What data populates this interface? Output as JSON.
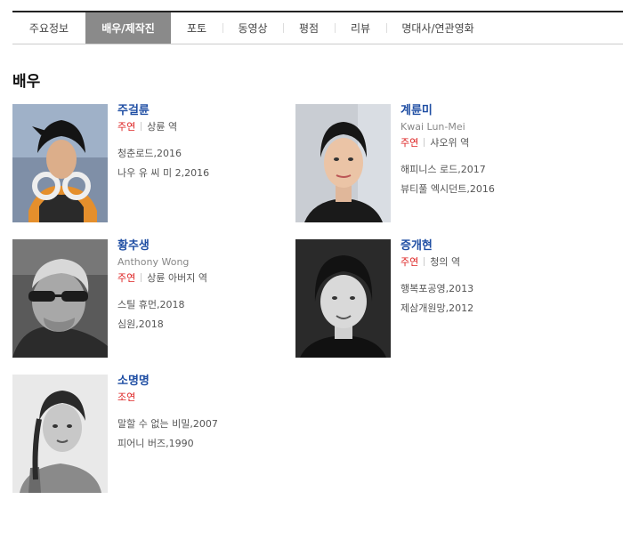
{
  "tabs": [
    {
      "label": "주요정보",
      "active": false
    },
    {
      "label": "배우/제작진",
      "active": true
    },
    {
      "label": "포토",
      "active": false
    },
    {
      "label": "동영상",
      "active": false
    },
    {
      "label": "평점",
      "active": false
    },
    {
      "label": "리뷰",
      "active": false
    },
    {
      "label": "명대사/연관영화",
      "active": false
    }
  ],
  "section": {
    "title": "배우"
  },
  "actors": [
    {
      "name": "주걸륜",
      "english_name": "",
      "role_type": "주연",
      "role_name": "상륜 역",
      "films": [
        "청춘로드,2016",
        "나우 유 씨 미 2,2016"
      ]
    },
    {
      "name": "계륜미",
      "english_name": "Kwai Lun-Mei",
      "role_type": "주연",
      "role_name": "샤오위 역",
      "films": [
        "해피니스 로드,2017",
        "뷰티풀 엑시던트,2016"
      ]
    },
    {
      "name": "황추생",
      "english_name": "Anthony Wong",
      "role_type": "주연",
      "role_name": "상륜 아버지 역",
      "films": [
        "스틸 휴먼,2018",
        "심원,2018"
      ]
    },
    {
      "name": "증개현",
      "english_name": "",
      "role_type": "주연",
      "role_name": "청의 역",
      "films": [
        "행복포공영,2013",
        "제삼개원망,2012"
      ]
    },
    {
      "name": "소명명",
      "english_name": "",
      "role_type": "조연",
      "role_name": "",
      "films": [
        "말할 수 없는 비밀,2007",
        "피어니 버즈,1990"
      ]
    }
  ]
}
